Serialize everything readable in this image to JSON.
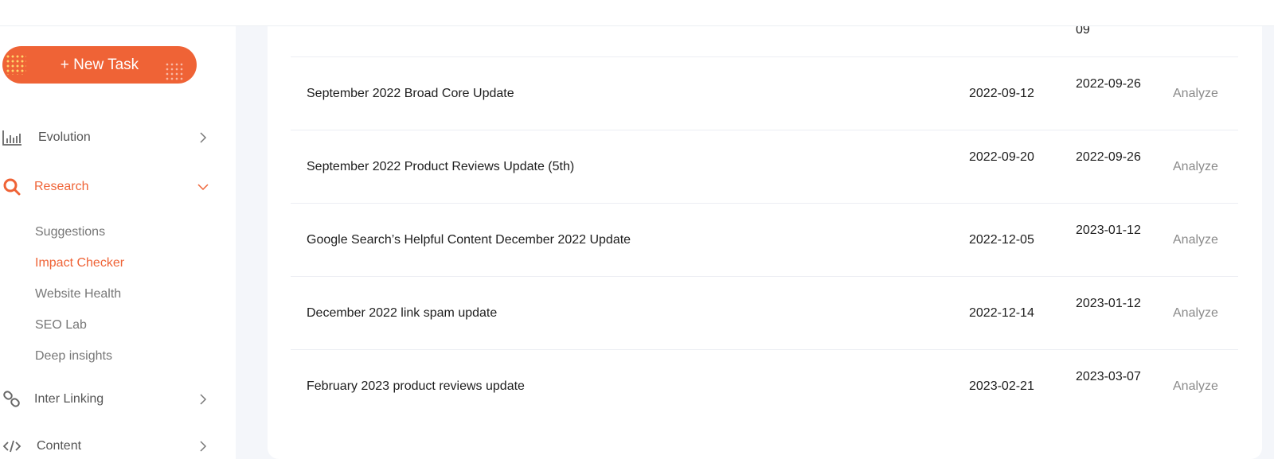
{
  "sidebar": {
    "new_task_label": "+ New Task",
    "nav": [
      {
        "label": "Evolution",
        "icon": "bar-chart-icon"
      },
      {
        "label": "Research",
        "icon": "search-icon"
      },
      {
        "label": "Inter Linking",
        "icon": "link-icon"
      },
      {
        "label": "Content",
        "icon": "code-icon"
      }
    ],
    "research_sub": [
      "Suggestions",
      "Impact Checker",
      "Website Health",
      "SEO Lab",
      "Deep insights"
    ]
  },
  "table": {
    "partial_top_end": "09",
    "rows": [
      {
        "name": "September 2022 Broad Core Update",
        "start": "2022-09-12",
        "end": "2022-09-26",
        "action": "Analyze"
      },
      {
        "name": "September 2022 Product Reviews Update (5th)",
        "start": "2022-09-20",
        "end": "2022-09-26",
        "action": "Analyze"
      },
      {
        "name": "Google Search’s Helpful Content December 2022 Update",
        "start": "2022-12-05",
        "end": "2023-01-12",
        "action": "Analyze"
      },
      {
        "name": "December 2022 link spam update",
        "start": "2022-12-14",
        "end": "2023-01-12",
        "action": "Analyze"
      },
      {
        "name": "February 2023 product reviews update",
        "start": "2023-02-21",
        "end": "2023-03-07",
        "action": "Analyze"
      }
    ]
  },
  "colors": {
    "accent": "#ef6336",
    "text": "#1d1d1d",
    "muted": "#8a8a8a",
    "background": "#f4f6fa"
  }
}
